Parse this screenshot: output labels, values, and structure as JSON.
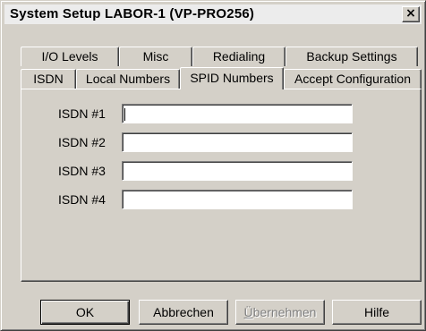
{
  "window": {
    "title": "System Setup  LABOR-1 (VP-PRO256)",
    "close_glyph": "×"
  },
  "tabs": {
    "row_back": [
      "I/O Levels",
      "Misc",
      "Redialing",
      "Backup Settings"
    ],
    "row_front": [
      "ISDN",
      "Local Numbers",
      "SPID Numbers",
      "Accept Configuration"
    ],
    "active": "SPID Numbers"
  },
  "fields": [
    {
      "label": "ISDN #1",
      "value": ""
    },
    {
      "label": "ISDN #2",
      "value": ""
    },
    {
      "label": "ISDN #3",
      "value": ""
    },
    {
      "label": "ISDN #4",
      "value": ""
    }
  ],
  "buttons": {
    "ok": "OK",
    "cancel": "Abbrechen",
    "apply": "Übernehmen",
    "apply_mnemonic": "Ü",
    "apply_rest": "bernehmen",
    "help": "Hilfe"
  }
}
